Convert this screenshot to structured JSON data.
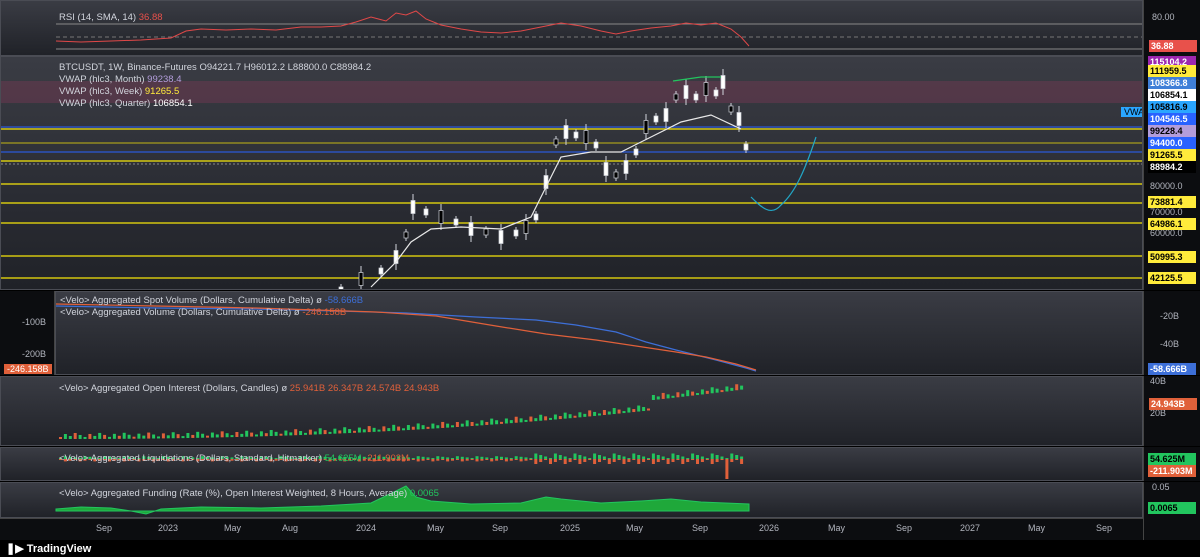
{
  "rsi": {
    "title": "RSI (14, SMA, 14)",
    "value": "36.88",
    "scale_top": "80.00",
    "tag": "36.88",
    "color": "#e8514b"
  },
  "main": {
    "symbol_line": "BTCUSDT, 1W, Binance-Futures",
    "ohlc": "O94221.7  H96012.2  L88800.0  C88984.2",
    "vwap_month_label": "VWAP (hlc3, Month)",
    "vwap_month_value": "99238.4",
    "vwap_week_label": "VWAP (hlc3, Week)",
    "vwap_week_value": "91265.5",
    "vwap_quarter_label": "VWAP (hlc3, Quarter)",
    "vwap_quarter_value": "106854.1",
    "vwap_flag": "VWAP",
    "price_tags": [
      {
        "v": "115104.2",
        "bg": "#9c27b0",
        "fg": "#ffffff"
      },
      {
        "v": "111959.5",
        "bg": "#ffeb3b",
        "fg": "#000000"
      },
      {
        "v": "108366.8",
        "bg": "#3f7fd8",
        "fg": "#ffffff"
      },
      {
        "v": "106854.1",
        "bg": "#ffffff",
        "fg": "#000000"
      },
      {
        "v": "105816.9",
        "bg": "#2aa6ff",
        "fg": "#000000"
      },
      {
        "v": "104546.5",
        "bg": "#2962ff",
        "fg": "#ffffff"
      },
      {
        "v": "99228.4",
        "bg": "#b39ddb",
        "fg": "#000000"
      },
      {
        "v": "94400.0",
        "bg": "#2962ff",
        "fg": "#ffffff"
      },
      {
        "v": "91265.5",
        "bg": "#ffeb3b",
        "fg": "#000000"
      },
      {
        "v": "88984.2",
        "bg": "#000000",
        "fg": "#ffffff"
      },
      {
        "v": "73881.4",
        "bg": "#ffeb3b",
        "fg": "#000000"
      },
      {
        "v": "64986.1",
        "bg": "#ffeb3b",
        "fg": "#000000"
      },
      {
        "v": "50995.3",
        "bg": "#ffeb3b",
        "fg": "#000000"
      },
      {
        "v": "42125.5",
        "bg": "#ffeb3b",
        "fg": "#000000"
      }
    ],
    "ticks": [
      "80000.0",
      "70000.0",
      "60000.0"
    ]
  },
  "spot": {
    "label1": "<Velo> Aggregated Spot Volume (Dollars, Cumulative Delta)",
    "value1": "-58.666B",
    "label2": "<Velo> Aggregated Volume (Dollars, Cumulative Delta)",
    "value2": "-246.158B",
    "left_ticks": [
      "-100B",
      "-200B"
    ],
    "left_tag": "-246.158B",
    "right_ticks": [
      "-20B",
      "-40B"
    ],
    "right_tag": "-58.666B"
  },
  "oi": {
    "label": "<Velo> Aggregated Open Interest (Dollars, Candles)",
    "values": "25.941B  26.347B  24.574B  24.943B",
    "tick_top": "40B",
    "tick_bottom": "20B",
    "tag": "24.943B"
  },
  "liq": {
    "label": "<Velo> Aggregated Liquidations (Dollars, Standard, Hitmarker)",
    "value1": "54.625M",
    "value2": "-211.903M",
    "tag_green": "54.625M",
    "tag_red": "-211.903M"
  },
  "funding": {
    "label": "<Velo> Aggregated Funding (Rate (%), Open Interest Weighted, 8 Hours, Average)",
    "value": "0.0065",
    "tick": "0.05",
    "tag": "0.0065"
  },
  "xaxis": [
    "Sep",
    "2023",
    "May",
    "Aug",
    "2024",
    "May",
    "Sep",
    "2025",
    "May",
    "Sep",
    "2026",
    "May",
    "Sep",
    "2027",
    "May",
    "Sep"
  ],
  "brand": "TradingView"
}
